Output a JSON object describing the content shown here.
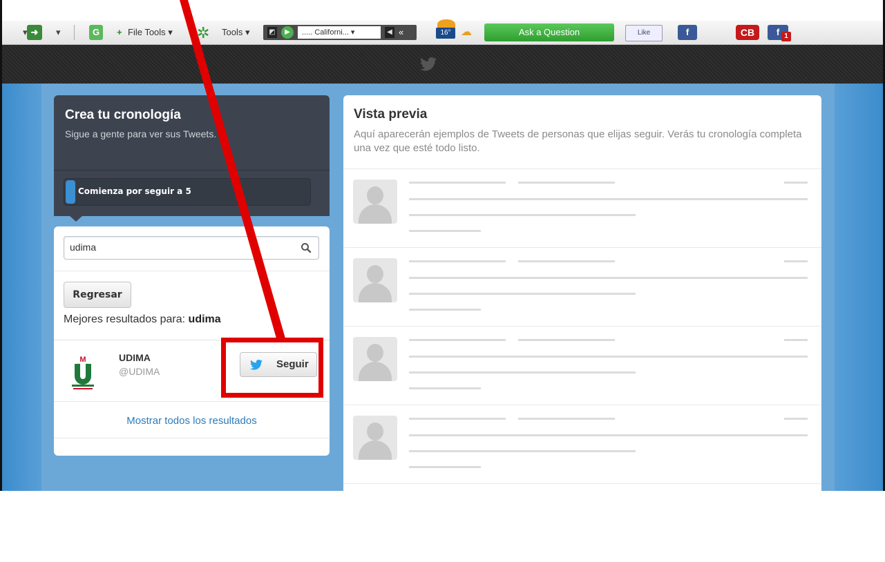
{
  "browser_toolbar": {
    "file_tools_label": "File Tools ▾",
    "tools_label": "Tools ▾",
    "radio_station": "..... Californi... ▾",
    "weather_temp": "16°",
    "ask_label": "Ask a Question",
    "like_label": "Like",
    "cb_label": "CB",
    "fb_badge": "1"
  },
  "timeline": {
    "title": "Crea tu cronología",
    "subtitle": "Sigue a gente para ver sus Tweets.",
    "progress_label": "Comienza por seguir a 5",
    "progress_fraction": 0.04
  },
  "search": {
    "value": "udima",
    "back_label": "Regresar",
    "results_prefix": "Mejores resultados para:",
    "results_query": "udima",
    "show_all_label": "Mostrar todos los resultados"
  },
  "result": {
    "name": "UDIMA",
    "handle": "@UDIMA",
    "follow_label": "Seguir",
    "logo_text": "udima"
  },
  "preview": {
    "title": "Vista previa",
    "description": "Aquí aparecerán ejemplos de Tweets de personas que elijas seguir. Verás tu cronología completa una vez que esté todo listo."
  },
  "colors": {
    "annotation": "#e00000",
    "link": "#2b7bb9",
    "ask_button": "#3fae3f",
    "dark_panel": "#3d4450"
  }
}
